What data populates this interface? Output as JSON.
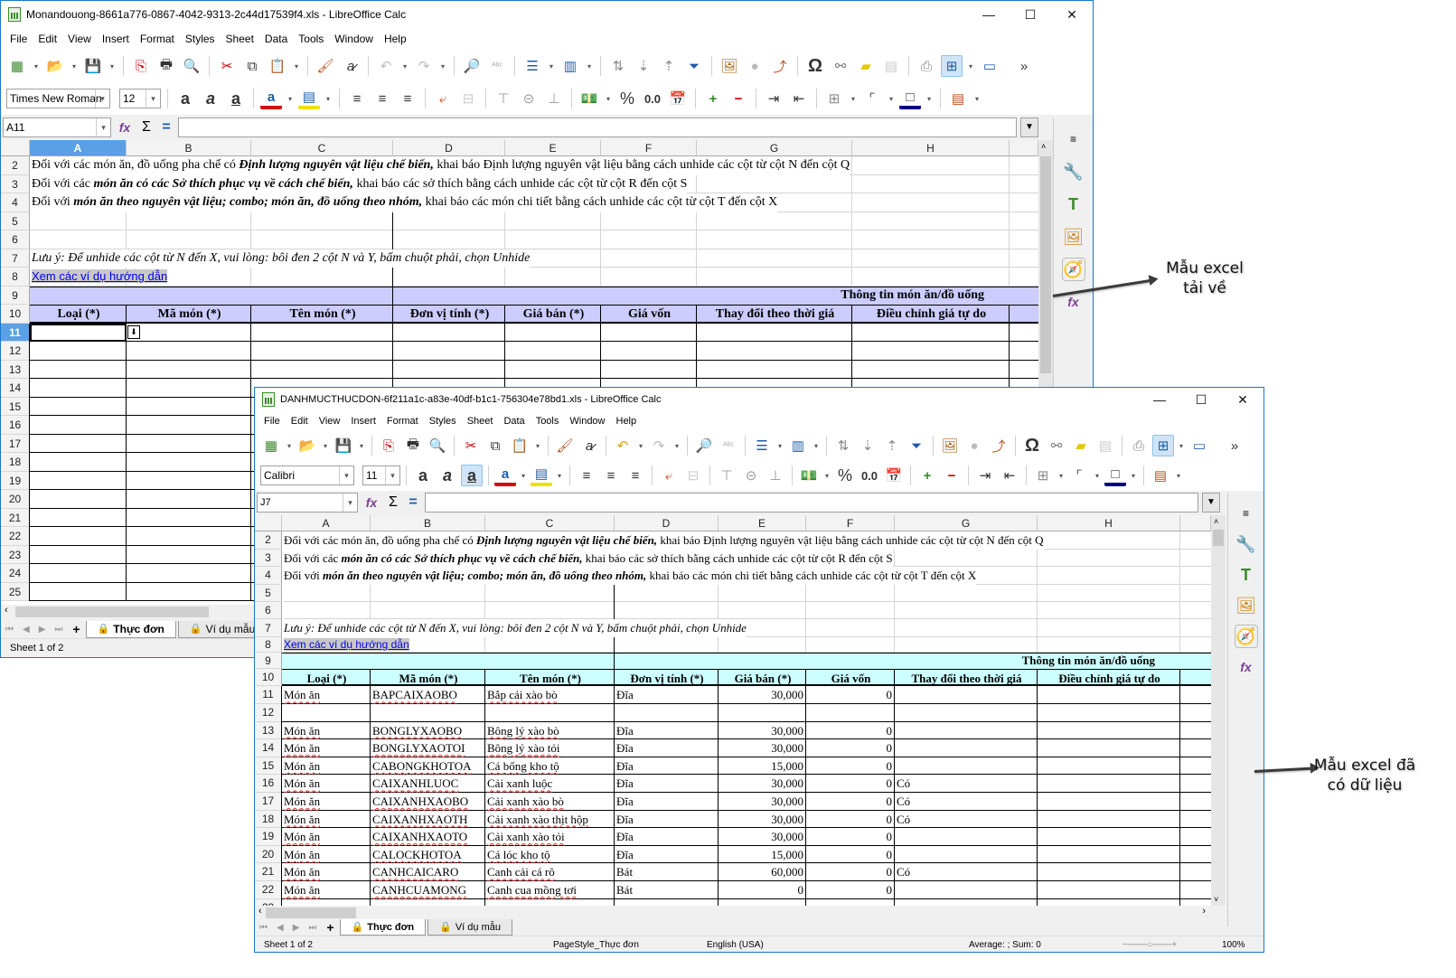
{
  "colors": {
    "header_band_win1": "#ccccff",
    "header_band_win2": "#ccffff",
    "selection": "#5aa0e6",
    "link": "#0000ee"
  },
  "menu": [
    "File",
    "Edit",
    "View",
    "Insert",
    "Format",
    "Styles",
    "Sheet",
    "Data",
    "Tools",
    "Window",
    "Help"
  ],
  "window_controls": {
    "minimize": "—",
    "maximize": "☐",
    "close": "✕"
  },
  "win1": {
    "title": "Monandouong-8661a776-0867-4042-9313-2c44d17539f4.xls - LibreOffice Calc",
    "font_name": "Times New Roman",
    "font_size": "12",
    "name_box": "A11",
    "columns": [
      "A",
      "B",
      "C",
      "D",
      "E",
      "F",
      "G",
      "H"
    ],
    "rows": [
      "2",
      "3",
      "4",
      "5",
      "6",
      "7",
      "8",
      "9",
      "10",
      "11",
      "12",
      "13",
      "14",
      "15",
      "16",
      "17",
      "18",
      "19",
      "20",
      "21",
      "22",
      "23",
      "24",
      "25"
    ],
    "sheet_tabs": [
      "Thực đơn",
      "Ví dụ mẫu"
    ],
    "status_sheet": "Sheet 1 of 2"
  },
  "win2": {
    "title": "DANHMUCTHUCDON-6f211a1c-a83e-40df-b1c1-756304e78bd1.xls - LibreOffice Calc",
    "font_name": "Calibri",
    "font_size": "11",
    "name_box": "J7",
    "columns": [
      "A",
      "B",
      "C",
      "D",
      "E",
      "F",
      "G",
      "H"
    ],
    "sheet_tabs": [
      "Thực đơn",
      "Ví dụ mẫu"
    ],
    "status": {
      "sheet": "Sheet 1 of 2",
      "page_style": "PageStyle_Thực đơn",
      "language": "English (USA)",
      "summary": "Average: ; Sum: 0",
      "zoom": "100%"
    },
    "data_rows": [
      {
        "row": "11",
        "loai": "Món ăn",
        "ma": "BAPCAIXAOBO",
        "ten": "Bắp cải xào bò",
        "dvt": "Đĩa",
        "gia_ban": "30,000",
        "gia_von": "0",
        "thay_doi": ""
      },
      {
        "row": "12",
        "loai": "",
        "ma": "",
        "ten": "",
        "dvt": "",
        "gia_ban": "",
        "gia_von": "",
        "thay_doi": ""
      },
      {
        "row": "13",
        "loai": "Món ăn",
        "ma": "BONGLYXAOBO",
        "ten": "Bông lý xào bò",
        "dvt": "Đĩa",
        "gia_ban": "30,000",
        "gia_von": "0",
        "thay_doi": ""
      },
      {
        "row": "14",
        "loai": "Món ăn",
        "ma": "BONGLYXAOTOI",
        "ten": "Bông lý xào tỏi",
        "dvt": "Đĩa",
        "gia_ban": "30,000",
        "gia_von": "0",
        "thay_doi": ""
      },
      {
        "row": "15",
        "loai": "Món ăn",
        "ma": "CABONGKHOTOA",
        "ten": "Cá bống kho tộ",
        "dvt": "Đĩa",
        "gia_ban": "15,000",
        "gia_von": "0",
        "thay_doi": ""
      },
      {
        "row": "16",
        "loai": "Món ăn",
        "ma": "CAIXANHLUOC",
        "ten": "Cải xanh luộc",
        "dvt": "Đĩa",
        "gia_ban": "30,000",
        "gia_von": "0",
        "thay_doi": "Có"
      },
      {
        "row": "17",
        "loai": "Món ăn",
        "ma": "CAIXANHXAOBO",
        "ten": "Cải xanh xào bò",
        "dvt": "Đĩa",
        "gia_ban": "30,000",
        "gia_von": "0",
        "thay_doi": "Có"
      },
      {
        "row": "18",
        "loai": "Món ăn",
        "ma": "CAIXANHXAOTH",
        "ten": "Cải xanh xào thịt hộp",
        "dvt": "Đĩa",
        "gia_ban": "30,000",
        "gia_von": "0",
        "thay_doi": "Có"
      },
      {
        "row": "19",
        "loai": "Món ăn",
        "ma": "CAIXANHXAOTO",
        "ten": "Cải xanh xào tỏi",
        "dvt": "Đĩa",
        "gia_ban": "30,000",
        "gia_von": "0",
        "thay_doi": ""
      },
      {
        "row": "20",
        "loai": "Món ăn",
        "ma": "CALOCKHOTOA",
        "ten": "Cá lóc kho tộ",
        "dvt": "Đĩa",
        "gia_ban": "15,000",
        "gia_von": "0",
        "thay_doi": ""
      },
      {
        "row": "21",
        "loai": "Món ăn",
        "ma": "CANHCAICARO",
        "ten": "Canh cải cá rô",
        "dvt": "Bát",
        "gia_ban": "60,000",
        "gia_von": "0",
        "thay_doi": "Có"
      },
      {
        "row": "22",
        "loai": "Món ăn",
        "ma": "CANHCUAMONG",
        "ten": "Canh cua mồng tơi",
        "dvt": "Bát",
        "gia_ban": "0",
        "gia_von": "0",
        "thay_doi": ""
      }
    ]
  },
  "sheet_text": {
    "r2_a": "Đối với các món ăn, đồ uống pha chế có ",
    "r2_b": "Định lượng nguyên vật liệu chế biến,",
    "r2_c": " khai báo Định lượng nguyên vật liệu bằng cách unhide các cột từ cột N đến cột Q",
    "r3_a": "Đối với các ",
    "r3_b": "món ăn có các Sở thích phục vụ về cách chế biến,",
    "r3_c": " khai báo các sở thích bằng cách unhide các cột từ cột R đến cột S",
    "r4_a": "Đối với ",
    "r4_b": "món ăn theo nguyên vật liệu; combo; món ăn, đồ uống theo nhóm,",
    "r4_c": " khai báo các món chi tiết bằng cách unhide các cột từ cột T đến cột X",
    "r7": "Lưu ý: Để unhide các cột từ N đến X, vui lòng: bôi đen 2 cột N và Y, bấm chuột phải, chọn Unhide",
    "r8_link": "Xem các ví dụ hướng dẫn",
    "r9_band": "Thông tin món ăn/đồ uống",
    "headers": [
      "Loại (*)",
      "Mã món (*)",
      "Tên món (*)",
      "Đơn vị tính (*)",
      "Giá bán (*)",
      "Giá vốn",
      "Thay đổi theo thời giá",
      "Điều chỉnh giá tự do"
    ]
  },
  "annotations": {
    "top": [
      "Mẫu excel",
      "tải về"
    ],
    "bottom": [
      "Mẫu excel đã",
      "có dữ liệu"
    ]
  }
}
